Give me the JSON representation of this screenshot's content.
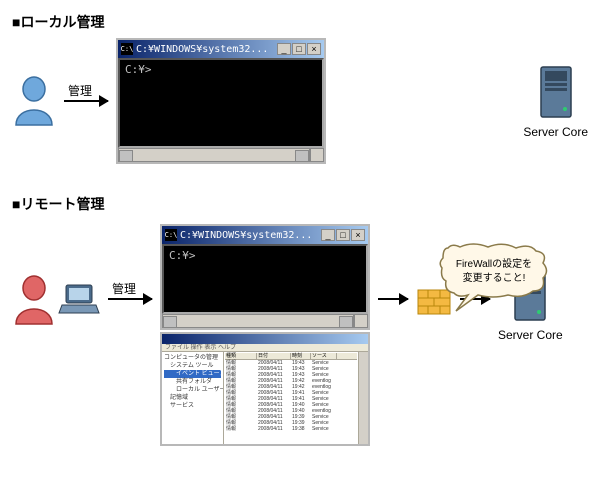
{
  "sections": {
    "local": {
      "title": "■ローカル管理"
    },
    "remote": {
      "title": "■リモート管理"
    }
  },
  "arrows": {
    "manage": "管理"
  },
  "cmd": {
    "title": "C:¥WINDOWS¥system32...",
    "prompt": "C:¥>"
  },
  "mmc": {
    "title": "コンピュータの管理",
    "toolbar": "ファイル 操作 表示 ヘルプ",
    "tree": {
      "root": "コンピュータの管理",
      "sys": "システム ツール",
      "ev": "イベント ビューア",
      "shared": "共有フォルダ",
      "users": "ローカル ユーザー",
      "storage": "記憶域",
      "svc": "サービス"
    },
    "list": {
      "headers": {
        "c1": "種類",
        "c2": "日付",
        "c3": "時刻",
        "c4": "ソース"
      },
      "rows": [
        {
          "c1": "情報",
          "c2": "2008/04/11",
          "c3": "19:43",
          "c4": "Service"
        },
        {
          "c1": "情報",
          "c2": "2008/04/11",
          "c3": "19:43",
          "c4": "Service"
        },
        {
          "c1": "情報",
          "c2": "2008/04/11",
          "c3": "19:43",
          "c4": "Service"
        },
        {
          "c1": "情報",
          "c2": "2008/04/11",
          "c3": "19:42",
          "c4": "eventlog"
        },
        {
          "c1": "情報",
          "c2": "2008/04/11",
          "c3": "19:42",
          "c4": "eventlog"
        },
        {
          "c1": "情報",
          "c2": "2008/04/11",
          "c3": "19:41",
          "c4": "Service"
        },
        {
          "c1": "情報",
          "c2": "2008/04/11",
          "c3": "19:41",
          "c4": "Service"
        },
        {
          "c1": "情報",
          "c2": "2008/04/11",
          "c3": "19:40",
          "c4": "Service"
        },
        {
          "c1": "情報",
          "c2": "2008/04/11",
          "c3": "19:40",
          "c4": "eventlog"
        },
        {
          "c1": "情報",
          "c2": "2008/04/11",
          "c3": "19:39",
          "c4": "Service"
        },
        {
          "c1": "情報",
          "c2": "2008/04/11",
          "c3": "19:39",
          "c4": "Service"
        },
        {
          "c1": "情報",
          "c2": "2008/04/11",
          "c3": "19:38",
          "c4": "Service"
        }
      ]
    }
  },
  "server": {
    "label": "Server Core"
  },
  "bubble": {
    "line1": "FireWallの設定を",
    "line2": "変更すること!"
  }
}
